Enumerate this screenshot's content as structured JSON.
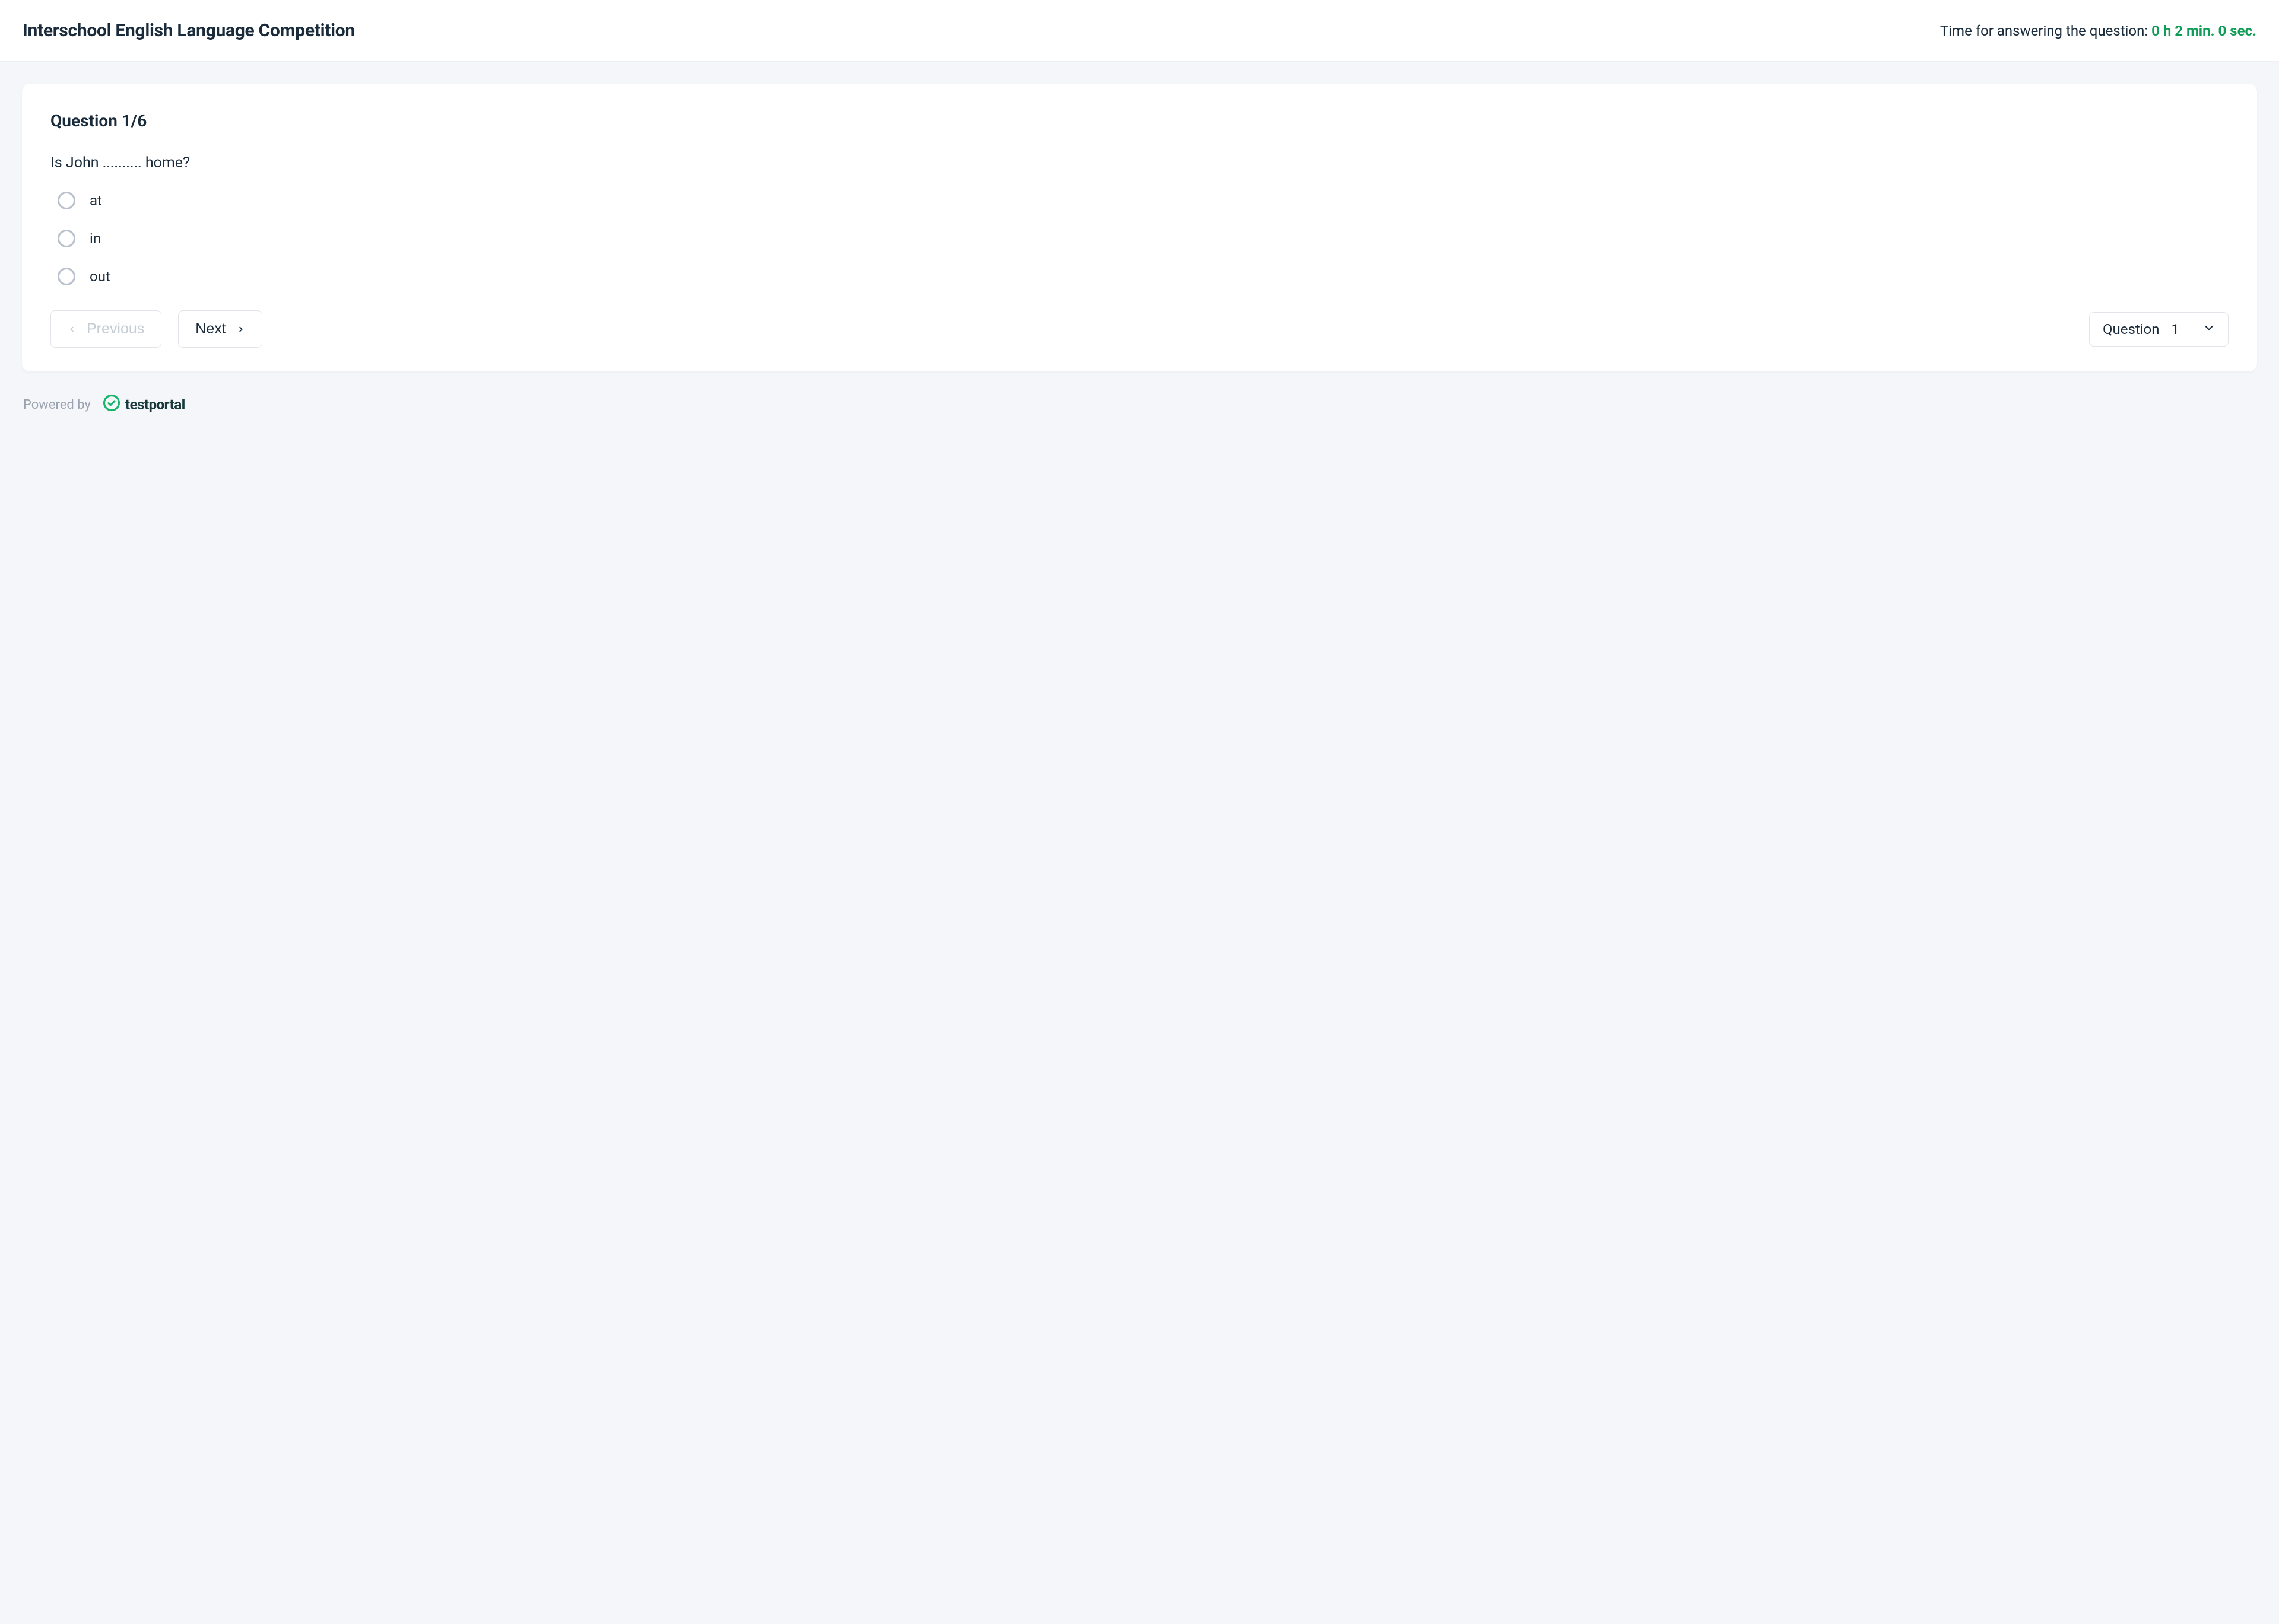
{
  "header": {
    "title": "Interschool English Language Competition",
    "timer_label": "Time for answering the question: ",
    "timer_value": "0 h 2 min. 0 sec."
  },
  "question": {
    "heading": "Question 1/6",
    "text": "Is John .......... home?",
    "options": [
      "at",
      "in",
      "out"
    ]
  },
  "nav": {
    "previous": "Previous",
    "next": "Next",
    "selector_label": "Question",
    "selector_value": "1"
  },
  "footer": {
    "powered_by": "Powered by",
    "brand": "testportal"
  }
}
